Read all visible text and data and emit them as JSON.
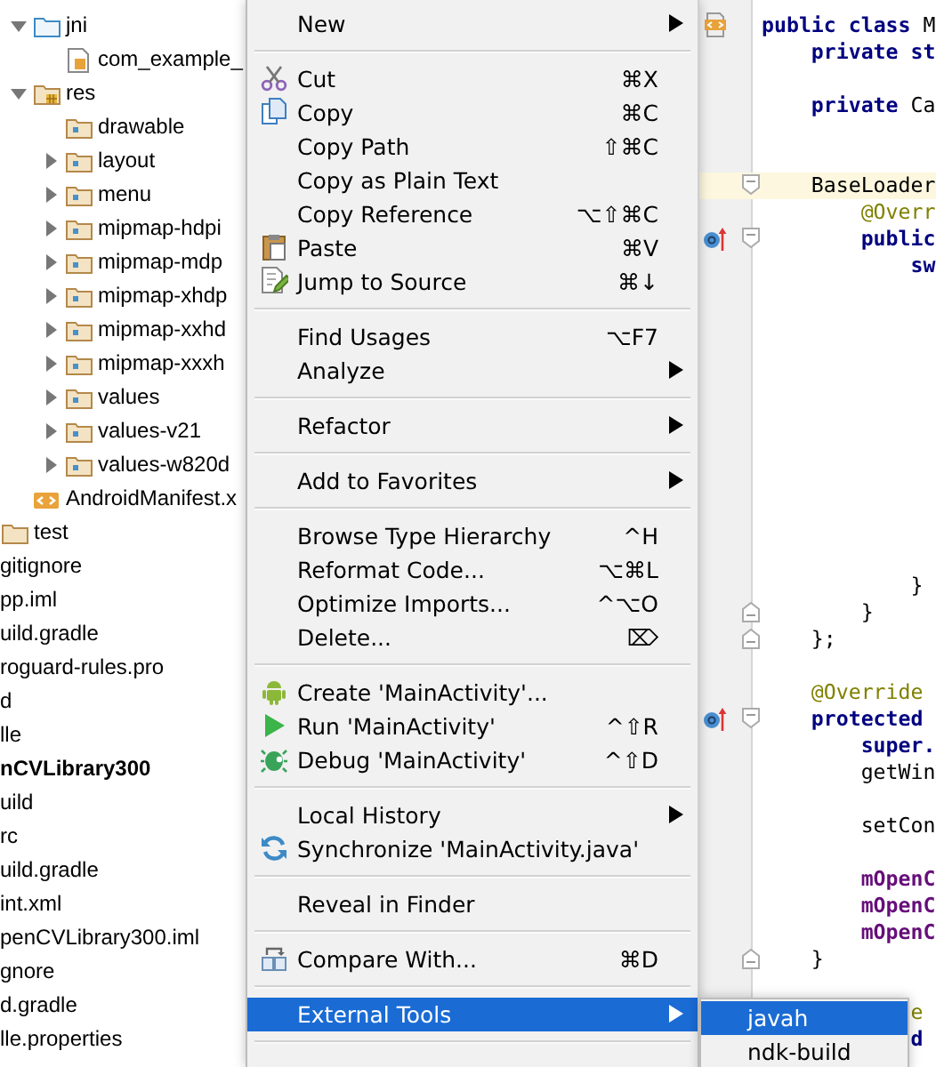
{
  "tree": {
    "inner": [
      {
        "label": "jni",
        "kind": "source-folder",
        "expanded": true,
        "children": [
          {
            "label": "com_example_",
            "kind": "header-file"
          }
        ]
      },
      {
        "label": "res",
        "kind": "resource-folder",
        "expanded": true,
        "children": [
          {
            "label": "drawable",
            "kind": "folder"
          },
          {
            "label": "layout",
            "kind": "folder",
            "expanded": false
          },
          {
            "label": "menu",
            "kind": "folder",
            "expanded": false
          },
          {
            "label": "mipmap-hdpi",
            "kind": "folder",
            "expanded": false
          },
          {
            "label": "mipmap-mdp",
            "kind": "folder",
            "expanded": false
          },
          {
            "label": "mipmap-xhdp",
            "kind": "folder",
            "expanded": false
          },
          {
            "label": "mipmap-xxhd",
            "kind": "folder",
            "expanded": false
          },
          {
            "label": "mipmap-xxxh",
            "kind": "folder",
            "expanded": false
          },
          {
            "label": "values",
            "kind": "folder",
            "expanded": false
          },
          {
            "label": "values-v21",
            "kind": "folder",
            "expanded": false
          },
          {
            "label": "values-w820d",
            "kind": "folder",
            "expanded": false
          }
        ]
      },
      {
        "label": "AndroidManifest.x",
        "kind": "manifest"
      }
    ],
    "outer": [
      {
        "label": "test",
        "kind": "plain-folder"
      },
      {
        "label": "gitignore",
        "kind": "plain"
      },
      {
        "label": "pp.iml",
        "kind": "plain"
      },
      {
        "label": "uild.gradle",
        "kind": "plain"
      },
      {
        "label": "roguard-rules.pro",
        "kind": "plain"
      },
      {
        "label": "d",
        "kind": "plain"
      },
      {
        "label": "lle",
        "kind": "plain"
      },
      {
        "label": "nCVLibrary300",
        "kind": "plain",
        "bold": true
      },
      {
        "label": "uild",
        "kind": "plain"
      },
      {
        "label": "rc",
        "kind": "plain"
      },
      {
        "label": "uild.gradle",
        "kind": "plain"
      },
      {
        "label": "int.xml",
        "kind": "plain"
      },
      {
        "label": "penCVLibrary300.iml",
        "kind": "plain"
      },
      {
        "label": "gnore",
        "kind": "plain"
      },
      {
        "label": "d.gradle",
        "kind": "plain"
      },
      {
        "label": "lle.properties",
        "kind": "plain"
      }
    ]
  },
  "editor": {
    "lines": [
      {
        "kind": "code",
        "current": false,
        "tokens": [
          {
            "kind": "keyword",
            "text": "public class"
          },
          {
            "kind": "plain",
            "text": " M"
          }
        ],
        "children": [
          {
            "kind": "code",
            "current": false,
            "tokens": [
              {
                "kind": "keyword",
                "text": "private st"
              }
            ]
          },
          {
            "kind": "blank",
            "current": false
          },
          {
            "kind": "code",
            "current": false,
            "tokens": [
              {
                "kind": "keyword",
                "text": "private"
              },
              {
                "kind": "plain",
                "text": " Ca"
              }
            ]
          },
          {
            "kind": "blank",
            "current": false
          },
          {
            "kind": "blank",
            "current": false
          },
          {
            "kind": "code",
            "current": true,
            "tokens": [
              {
                "kind": "plain",
                "text": "BaseLoader"
              }
            ],
            "children": [
              {
                "kind": "code",
                "current": false,
                "tokens": [
                  {
                    "kind": "annotation",
                    "text": "@Overr"
                  }
                ]
              },
              {
                "kind": "code",
                "current": false,
                "tokens": [
                  {
                    "kind": "keyword",
                    "text": "public"
                  }
                ],
                "children": [
                  {
                    "kind": "code",
                    "current": false,
                    "tokens": [
                      {
                        "kind": "keyword",
                        "text": "sw"
                      }
                    ]
                  },
                  {
                    "kind": "blank",
                    "current": false
                  },
                  {
                    "kind": "blank",
                    "current": false
                  },
                  {
                    "kind": "blank",
                    "current": false
                  },
                  {
                    "kind": "blank",
                    "current": false
                  },
                  {
                    "kind": "blank",
                    "current": false
                  },
                  {
                    "kind": "blank",
                    "current": false
                  },
                  {
                    "kind": "blank",
                    "current": false
                  },
                  {
                    "kind": "blank",
                    "current": false
                  },
                  {
                    "kind": "blank",
                    "current": false
                  },
                  {
                    "kind": "blank",
                    "current": false
                  },
                  {
                    "kind": "blank",
                    "current": false
                  },
                  {
                    "kind": "code",
                    "current": false,
                    "tokens": [
                      {
                        "kind": "plain",
                        "text": "}"
                      }
                    ]
                  }
                ]
              },
              {
                "kind": "code",
                "current": false,
                "tokens": [
                  {
                    "kind": "plain",
                    "text": "}"
                  }
                ]
              }
            ]
          },
          {
            "kind": "code",
            "current": false,
            "tokens": [
              {
                "kind": "plain",
                "text": "};"
              }
            ]
          },
          {
            "kind": "blank",
            "current": false
          },
          {
            "kind": "code",
            "current": false,
            "tokens": [
              {
                "kind": "annotation",
                "text": "@Override"
              }
            ]
          },
          {
            "kind": "code",
            "current": false,
            "tokens": [
              {
                "kind": "keyword",
                "text": "protected"
              }
            ],
            "children": [
              {
                "kind": "code",
                "current": false,
                "tokens": [
                  {
                    "kind": "keyword",
                    "text": "super."
                  }
                ]
              },
              {
                "kind": "code",
                "current": false,
                "tokens": [
                  {
                    "kind": "plain",
                    "text": "getWin"
                  }
                ]
              },
              {
                "kind": "blank",
                "current": false
              },
              {
                "kind": "code",
                "current": false,
                "tokens": [
                  {
                    "kind": "plain",
                    "text": "setCon"
                  }
                ]
              },
              {
                "kind": "blank",
                "current": false
              },
              {
                "kind": "code",
                "current": false,
                "tokens": [
                  {
                    "kind": "field",
                    "text": "mOpenC"
                  }
                ]
              },
              {
                "kind": "code",
                "current": false,
                "tokens": [
                  {
                    "kind": "field",
                    "text": "mOpenC"
                  }
                ]
              },
              {
                "kind": "code",
                "current": false,
                "tokens": [
                  {
                    "kind": "field",
                    "text": "mOpenC"
                  }
                ]
              }
            ]
          },
          {
            "kind": "code",
            "current": false,
            "tokens": [
              {
                "kind": "plain",
                "text": "}"
              }
            ]
          },
          {
            "kind": "blank",
            "current": false
          },
          {
            "kind": "covered",
            "current": false,
            "tokens": [
              {
                "kind": "annotation",
                "text": "e"
              }
            ]
          },
          {
            "kind": "covered",
            "current": false,
            "tokens": [
              {
                "kind": "keyword",
                "text": "d"
              }
            ]
          }
        ]
      }
    ]
  },
  "context_menu": {
    "entries": [
      {
        "kind": "item",
        "label": "New",
        "submenu": true,
        "selected": false
      },
      {
        "kind": "separator"
      },
      {
        "kind": "item",
        "label": "Cut",
        "shortcut": "⌘X",
        "selected": false
      },
      {
        "kind": "item",
        "label": "Copy",
        "shortcut": "⌘C",
        "selected": false
      },
      {
        "kind": "item",
        "label": "Copy Path",
        "shortcut": "⇧⌘C",
        "selected": false
      },
      {
        "kind": "item",
        "label": "Copy as Plain Text",
        "selected": false
      },
      {
        "kind": "item",
        "label": "Copy Reference",
        "shortcut": "⌥⇧⌘C",
        "selected": false
      },
      {
        "kind": "item",
        "label": "Paste",
        "shortcut": "⌘V",
        "selected": false
      },
      {
        "kind": "item",
        "label": "Jump to Source",
        "shortcut": "⌘↓",
        "selected": false
      },
      {
        "kind": "separator"
      },
      {
        "kind": "item",
        "label": "Find Usages",
        "shortcut": "⌥F7",
        "selected": false
      },
      {
        "kind": "item",
        "label": "Analyze",
        "submenu": true,
        "selected": false
      },
      {
        "kind": "separator"
      },
      {
        "kind": "item",
        "label": "Refactor",
        "submenu": true,
        "selected": false
      },
      {
        "kind": "separator"
      },
      {
        "kind": "item",
        "label": "Add to Favorites",
        "submenu": true,
        "selected": false
      },
      {
        "kind": "separator"
      },
      {
        "kind": "item",
        "label": "Browse Type Hierarchy",
        "shortcut": "^H",
        "selected": false
      },
      {
        "kind": "item",
        "label": "Reformat Code...",
        "shortcut": "⌥⌘L",
        "selected": false
      },
      {
        "kind": "item",
        "label": "Optimize Imports...",
        "shortcut": "^⌥O",
        "selected": false
      },
      {
        "kind": "item",
        "label": "Delete...",
        "shortcut": "⌦",
        "selected": false
      },
      {
        "kind": "separator"
      },
      {
        "kind": "item",
        "label": "Create 'MainActivity'...",
        "selected": false
      },
      {
        "kind": "item",
        "label": "Run 'MainActivity'",
        "shortcut": "^⇧R",
        "selected": false
      },
      {
        "kind": "item",
        "label": "Debug 'MainActivity'",
        "shortcut": "^⇧D",
        "selected": false
      },
      {
        "kind": "separator"
      },
      {
        "kind": "item",
        "label": "Local History",
        "submenu": true,
        "selected": false
      },
      {
        "kind": "item",
        "label": "Synchronize 'MainActivity.java'",
        "selected": false
      },
      {
        "kind": "separator"
      },
      {
        "kind": "item",
        "label": "Reveal in Finder",
        "selected": false
      },
      {
        "kind": "separator"
      },
      {
        "kind": "item",
        "label": "Compare With...",
        "shortcut": "⌘D",
        "selected": false
      },
      {
        "kind": "separator"
      },
      {
        "kind": "item",
        "label": "External Tools",
        "submenu": true,
        "selected": true
      },
      {
        "kind": "separator"
      }
    ]
  },
  "submenu": {
    "items": [
      {
        "label": "javah",
        "selected": true
      },
      {
        "label": "ndk-build",
        "selected": false
      }
    ]
  }
}
